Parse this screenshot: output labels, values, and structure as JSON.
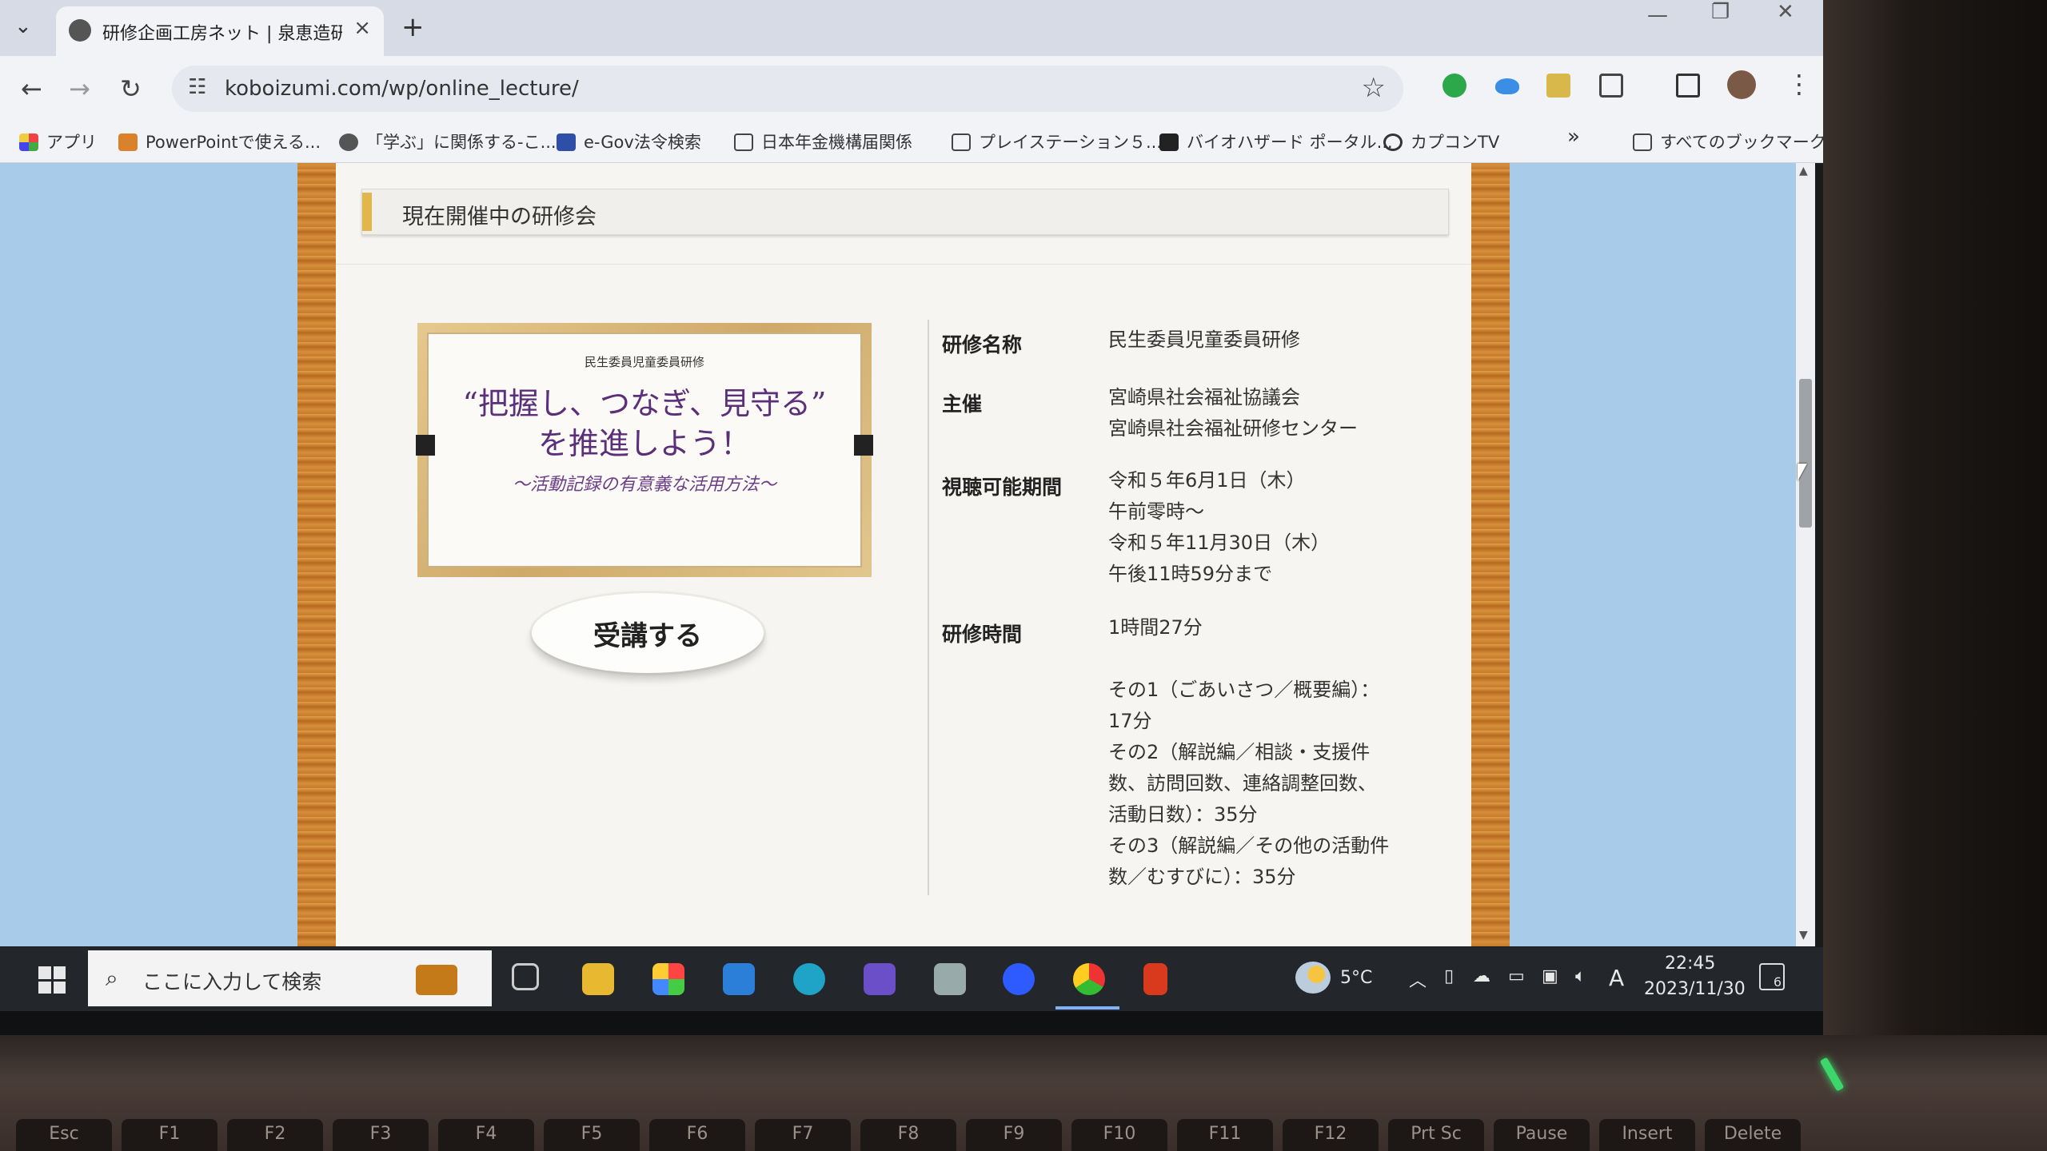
{
  "browser": {
    "tab_title": "研修企画工房ネット | 泉恵造研修",
    "tab_close": "×",
    "new_tab": "+",
    "url": "koboizumi.com/wp/online_lecture/"
  },
  "bookmarks": [
    {
      "label": "アプリ"
    },
    {
      "label": "PowerPointで使える..."
    },
    {
      "label": "「学ぶ」に関係する-こ..."
    },
    {
      "label": "e-Gov法令検索"
    },
    {
      "label": "日本年金機構届関係"
    },
    {
      "label": "プレイステーション５..."
    },
    {
      "label": "バイオハザード ポータル..."
    },
    {
      "label": "カプコンTV"
    },
    {
      "label": "すべてのブックマーク"
    }
  ],
  "bookmarks_overflow": "»",
  "page": {
    "section_title": "現在開催中の研修会",
    "lecture_card": {
      "small_label": "民生委員児童委員研修",
      "title_line1": "“把握し、つなぎ、見守る”",
      "title_line2": "を推進しよう！",
      "subtitle": "～活動記録の有意義な活用方法～"
    },
    "attend_button": "受講する",
    "info": {
      "name_label": "研修名称",
      "name_value": "民生委員児童委員研修",
      "host_label": "主催",
      "host_value1": "宮崎県社会福祉協議会",
      "host_value2": "宮崎県社会福祉研修センター",
      "period_label": "視聴可能期間",
      "period_lines": [
        "令和５年6月1日（木）",
        "午前零時～",
        "令和５年11月30日（木）",
        "午後11時59分まで"
      ],
      "time_label": "研修時間",
      "time_value": "1時間27分",
      "parts": [
        "その1（ごあいさつ／概要編）：",
        "17分",
        "その2（解説編／相談・支援件",
        "数、訪問回数、連絡調整回数、",
        "活動日数）：35分",
        "その3（解説編／その他の活動件",
        "数／むすびに）：35分"
      ]
    }
  },
  "taskbar": {
    "search_placeholder": "ここに入力して検索",
    "temperature": "5°C",
    "ime": "A",
    "time": "22:45",
    "date": "2023/11/30",
    "notification_count": "6"
  },
  "keyboard": [
    "Esc",
    "F1",
    "F2",
    "F3",
    "F4",
    "F5",
    "F6",
    "F7",
    "F8",
    "F9",
    "F10",
    "F11",
    "F12",
    "Prt Sc",
    "Pause",
    "Insert",
    "Delete"
  ],
  "colors": {
    "page_bg": "#a8cbea",
    "accent_gold": "#e1b74a",
    "lecture_title": "#5b2f7a"
  }
}
